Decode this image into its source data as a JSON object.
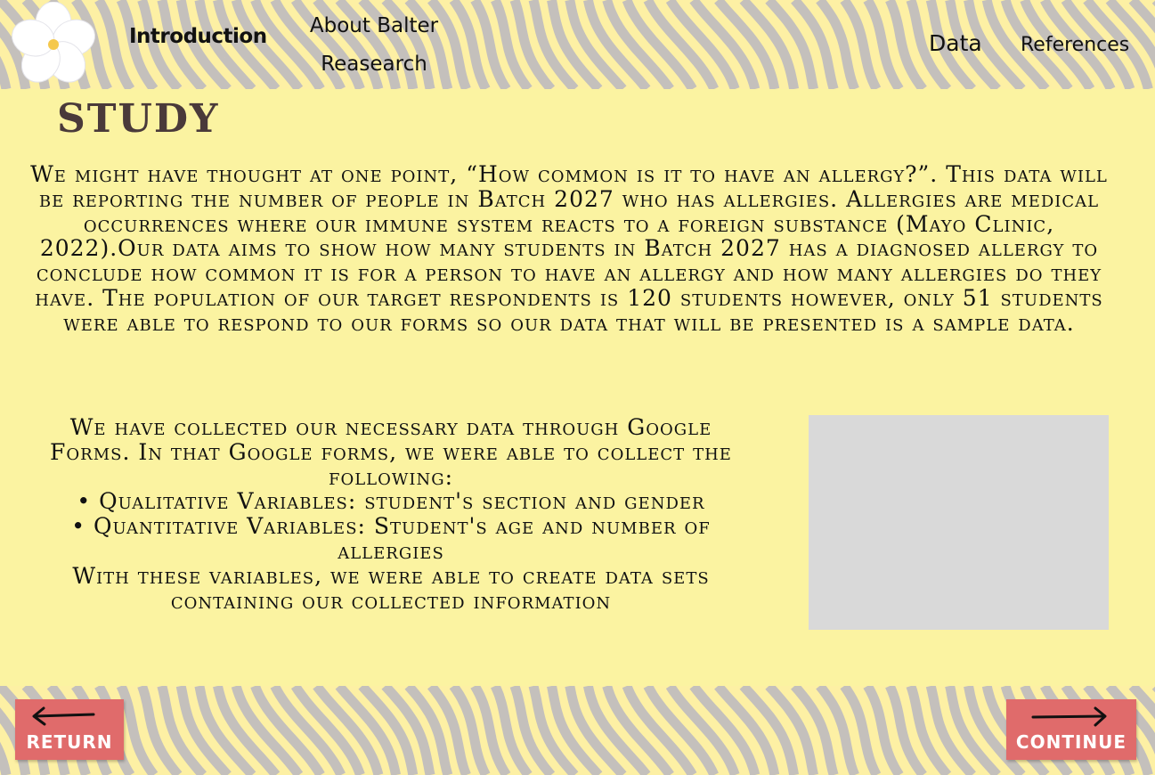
{
  "nav": {
    "introduction": "Introduction",
    "about_line1": "About Balter",
    "about_line2": "Reasearch",
    "data": "Data",
    "references": "References"
  },
  "study": {
    "title": "Study",
    "paragraph1": "We might have thought at one point, “How common is it to have an allergy?”. This data will be reporting the number of people in Batch 2027 who has allergies. Allergies are medical occurrences where our immune system reacts to a foreign substance (Mayo Clinic, 2022).Our data aims to show how many students in Batch 2027 has a diagnosed allergy to conclude how common it is for a person to have an allergy and how many allergies do they have. The population of our target respondents is 120 students however, only 51 students were able to respond to our forms so our data that will be presented is a sample data.",
    "paragraph2_intro": "We have collected our necessary data through Google Forms. In that Google forms, we were able to collect the following:",
    "bullet1": "• Qualitative Variables: student's section and gender",
    "bullet2": "• Quantitative Variables: Student's age and number of allergies",
    "paragraph2_outro": "With these variables, we were able to create data sets containing our collected information"
  },
  "buttons": {
    "return": "RETURN",
    "continue": "CONTINUE"
  },
  "colors": {
    "background": "#fbf3a1",
    "wave_gray": "#c4c0bc",
    "button": "#e06b6b",
    "title": "#4a3a3a",
    "placeholder": "#d9d9d9"
  },
  "icons": {
    "logo": "white-flower-icon",
    "return": "left-arrow-icon",
    "continue": "right-arrow-icon"
  }
}
